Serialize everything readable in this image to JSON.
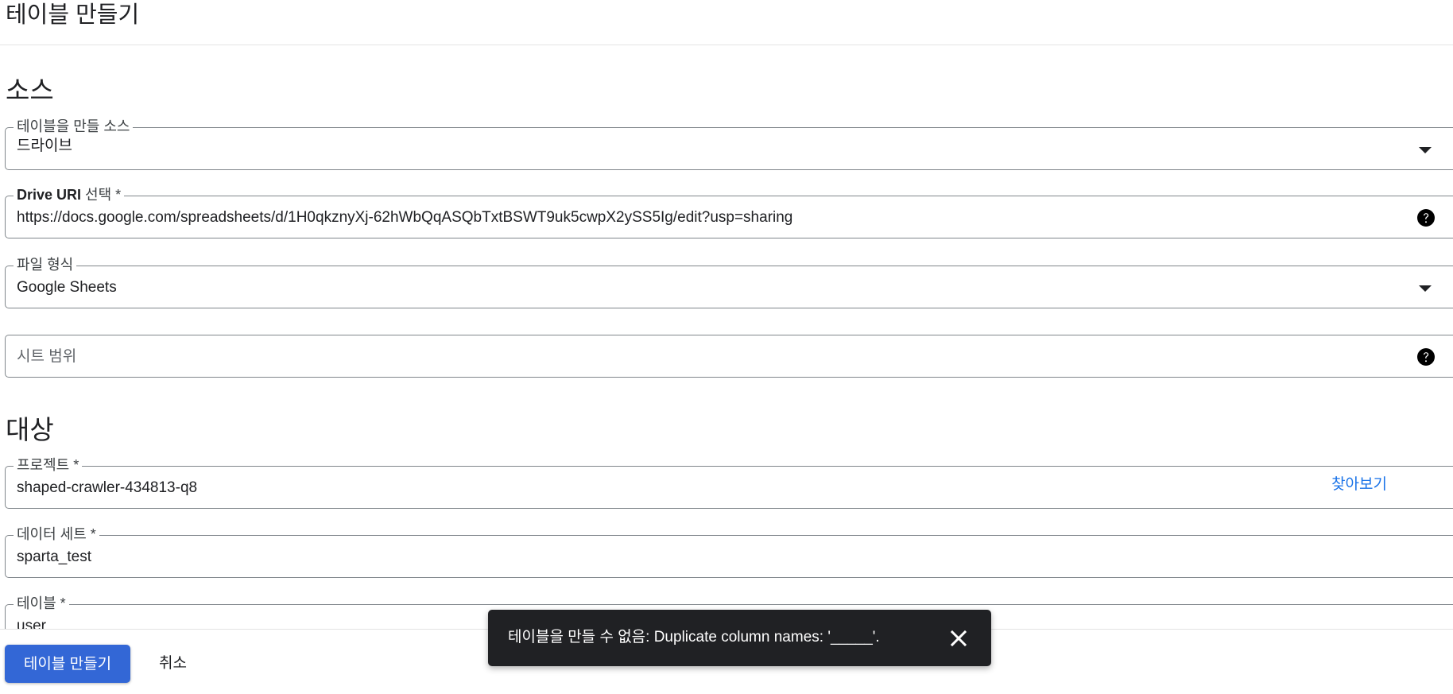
{
  "header": {
    "title": "테이블 만들기"
  },
  "source_section": {
    "title": "소스",
    "source_field": {
      "label": "테이블을 만들 소스",
      "value": "드라이브",
      "icon": "dropdown-arrow-icon"
    },
    "drive_uri_field": {
      "label_strong": "Drive URI",
      "label_rest": " 선택 *",
      "value": "https://docs.google.com/spreadsheets/d/1H0qkznyXj-62hWbQqASQbTxtBSWT9uk5cwpX2ySS5Ig/edit?usp=sharing",
      "icon": "help-icon"
    },
    "file_format_field": {
      "label": "파일 형식",
      "value": "Google Sheets",
      "icon": "dropdown-arrow-icon"
    },
    "sheet_range_field": {
      "placeholder": "시트 범위",
      "icon": "help-icon"
    }
  },
  "destination_section": {
    "title": "대상",
    "project_field": {
      "label": "프로젝트 *",
      "value": "shaped-crawler-434813-q8",
      "browse_label": "찾아보기"
    },
    "dataset_field": {
      "label": "데이터 세트 *",
      "value": "sparta_test"
    },
    "table_field": {
      "label": "테이블 *",
      "value": "user"
    }
  },
  "footer": {
    "create_label": "테이블 만들기",
    "cancel_label": "취소"
  },
  "snackbar": {
    "message": "테이블을 만들 수 없음: Duplicate column names: '_____'.",
    "close_icon": "close-icon"
  },
  "colors": {
    "primary": "#3367d6",
    "link": "#1a73e8",
    "snackbar_bg": "#202124",
    "border": "#80868b"
  }
}
